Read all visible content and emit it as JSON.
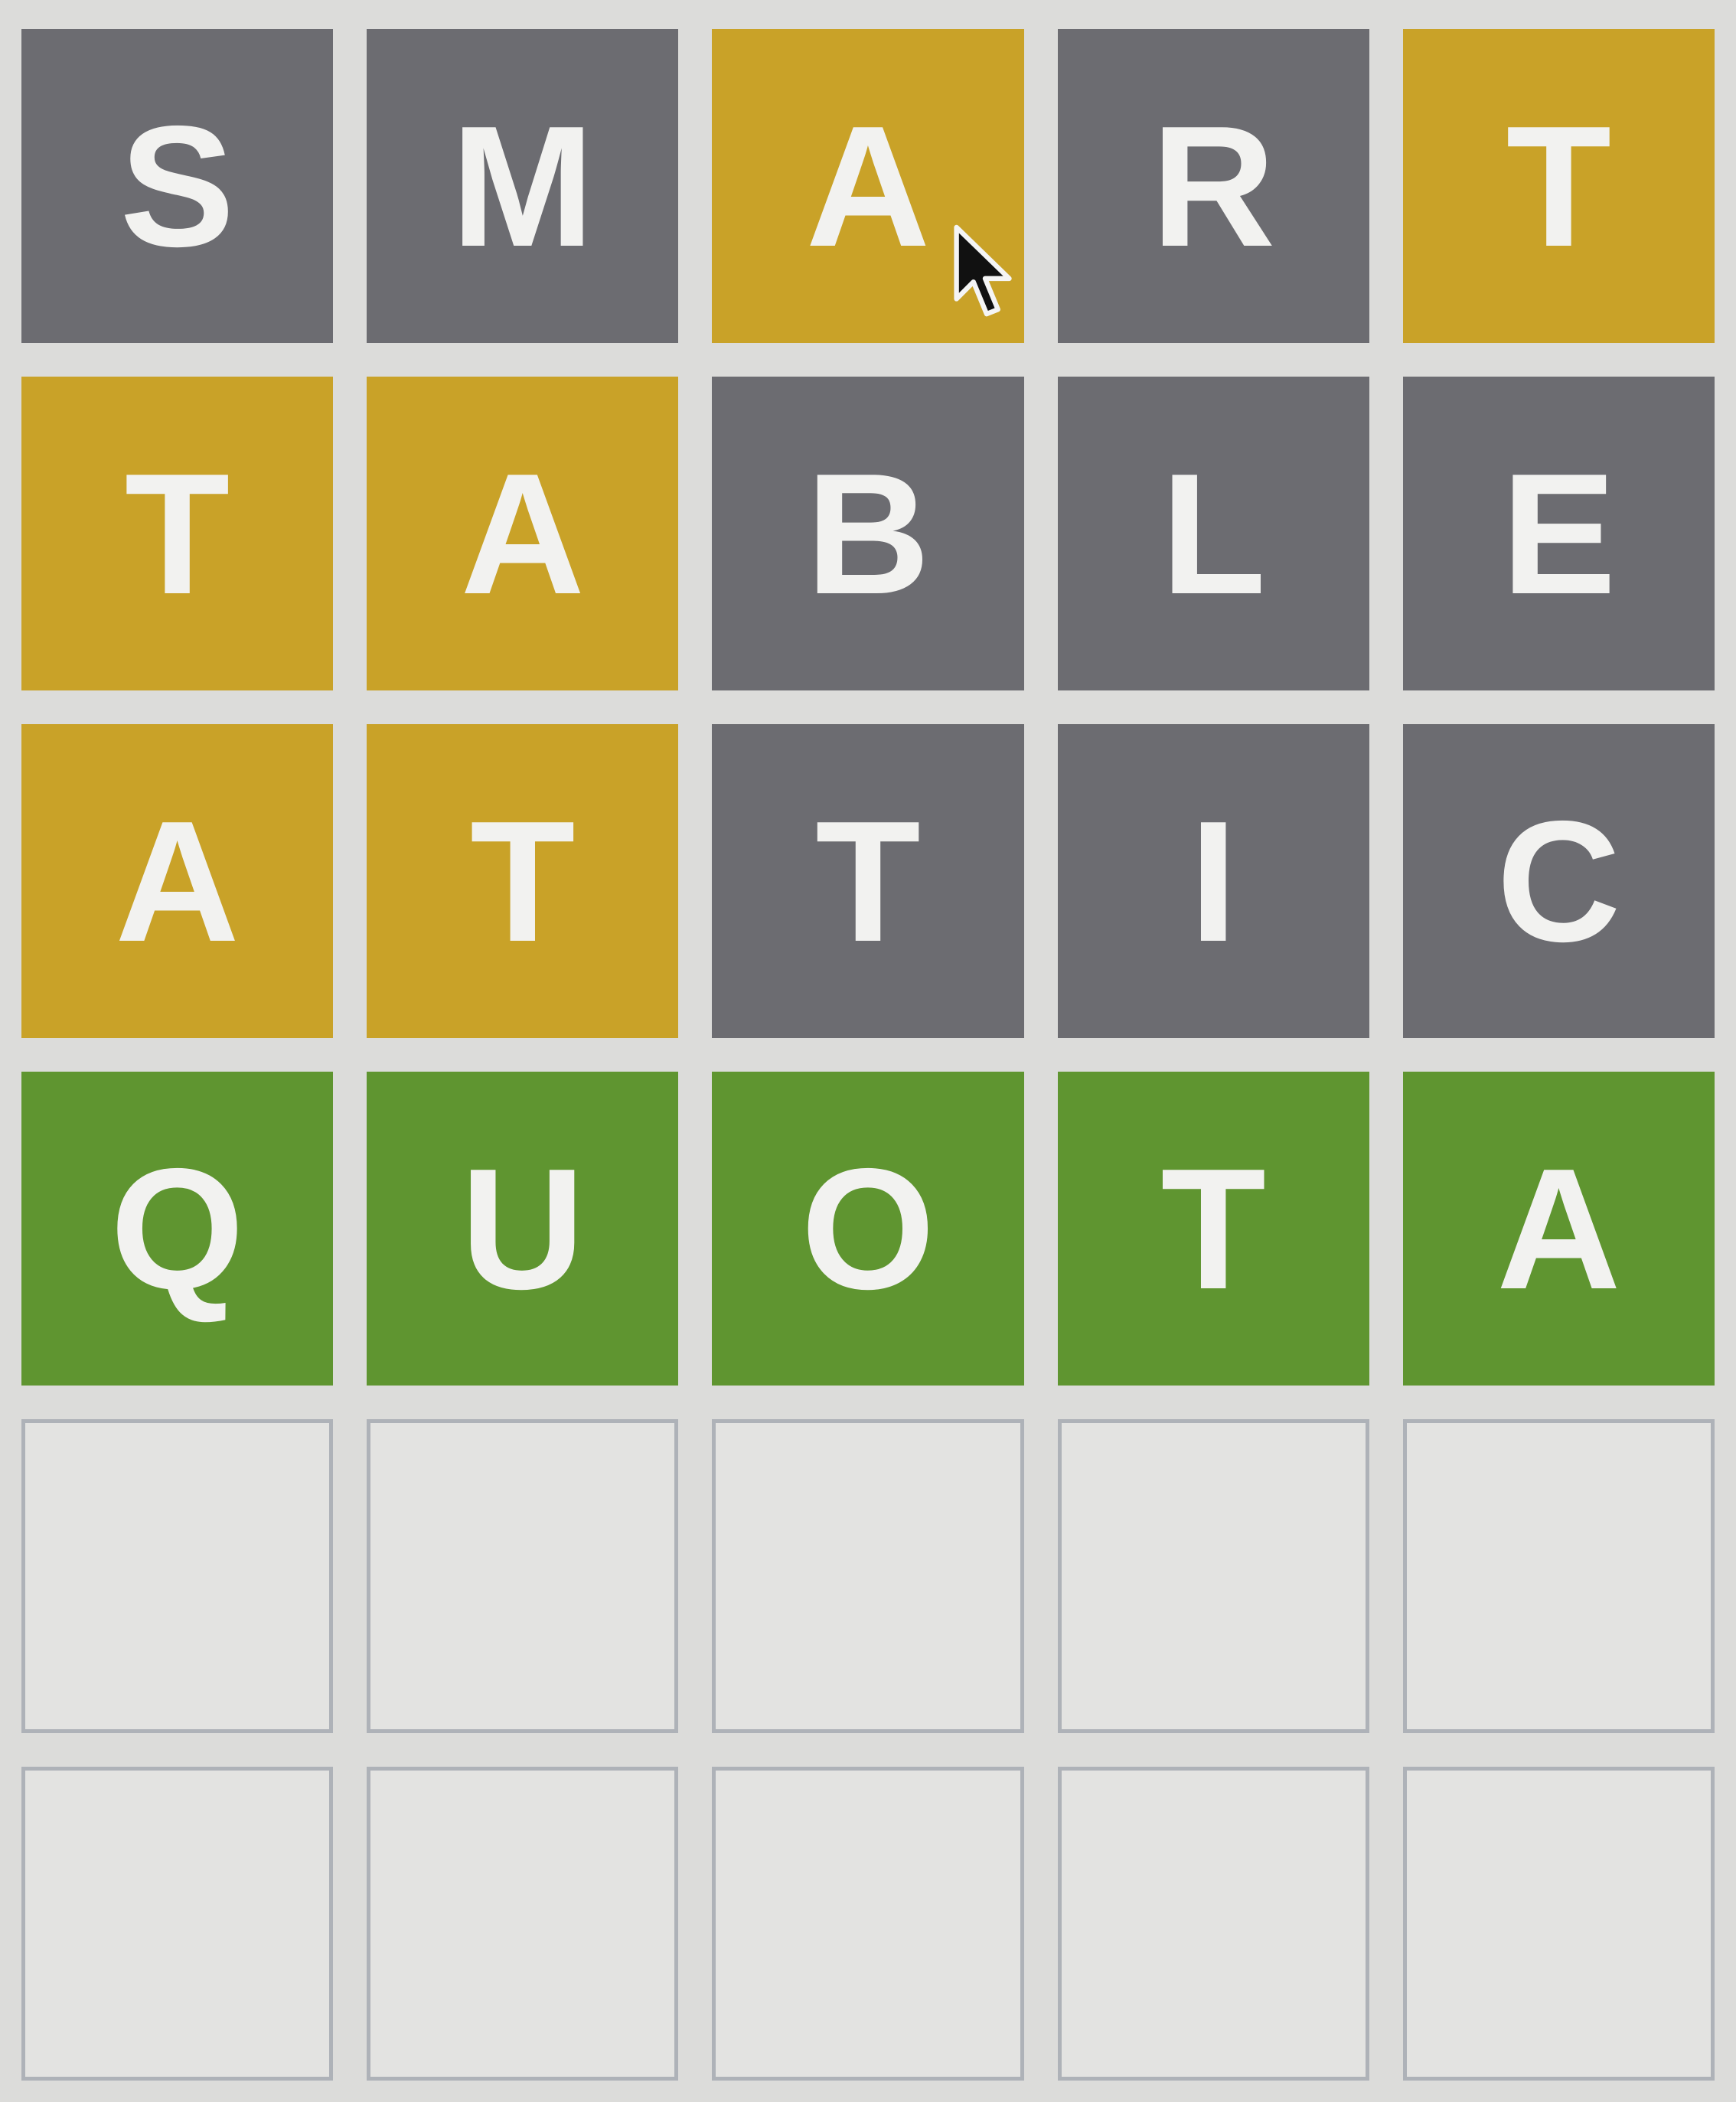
{
  "colors": {
    "absent": "#6c6c71",
    "present": "#c9a228",
    "correct": "#5f9530",
    "empty": "#e3e3e1",
    "empty_border": "#aeb2b8",
    "letter": "#f2f2f0",
    "background": "#dcdcda"
  },
  "board": {
    "rows": [
      {
        "tiles": [
          {
            "letter": "S",
            "state": "absent"
          },
          {
            "letter": "M",
            "state": "absent"
          },
          {
            "letter": "A",
            "state": "present"
          },
          {
            "letter": "R",
            "state": "absent"
          },
          {
            "letter": "T",
            "state": "present"
          }
        ]
      },
      {
        "tiles": [
          {
            "letter": "T",
            "state": "present"
          },
          {
            "letter": "A",
            "state": "present"
          },
          {
            "letter": "B",
            "state": "absent"
          },
          {
            "letter": "L",
            "state": "absent"
          },
          {
            "letter": "E",
            "state": "absent"
          }
        ]
      },
      {
        "tiles": [
          {
            "letter": "A",
            "state": "present"
          },
          {
            "letter": "T",
            "state": "present"
          },
          {
            "letter": "T",
            "state": "absent"
          },
          {
            "letter": "I",
            "state": "absent"
          },
          {
            "letter": "C",
            "state": "absent"
          }
        ]
      },
      {
        "tiles": [
          {
            "letter": "Q",
            "state": "correct"
          },
          {
            "letter": "U",
            "state": "correct"
          },
          {
            "letter": "O",
            "state": "correct"
          },
          {
            "letter": "T",
            "state": "correct"
          },
          {
            "letter": "A",
            "state": "correct"
          }
        ]
      },
      {
        "tiles": [
          {
            "letter": "",
            "state": "empty"
          },
          {
            "letter": "",
            "state": "empty"
          },
          {
            "letter": "",
            "state": "empty"
          },
          {
            "letter": "",
            "state": "empty"
          },
          {
            "letter": "",
            "state": "empty"
          }
        ]
      },
      {
        "tiles": [
          {
            "letter": "",
            "state": "empty"
          },
          {
            "letter": "",
            "state": "empty"
          },
          {
            "letter": "",
            "state": "empty"
          },
          {
            "letter": "",
            "state": "empty"
          },
          {
            "letter": "",
            "state": "empty"
          }
        ]
      }
    ]
  },
  "cursor": {
    "icon": "mouse-pointer-icon"
  }
}
